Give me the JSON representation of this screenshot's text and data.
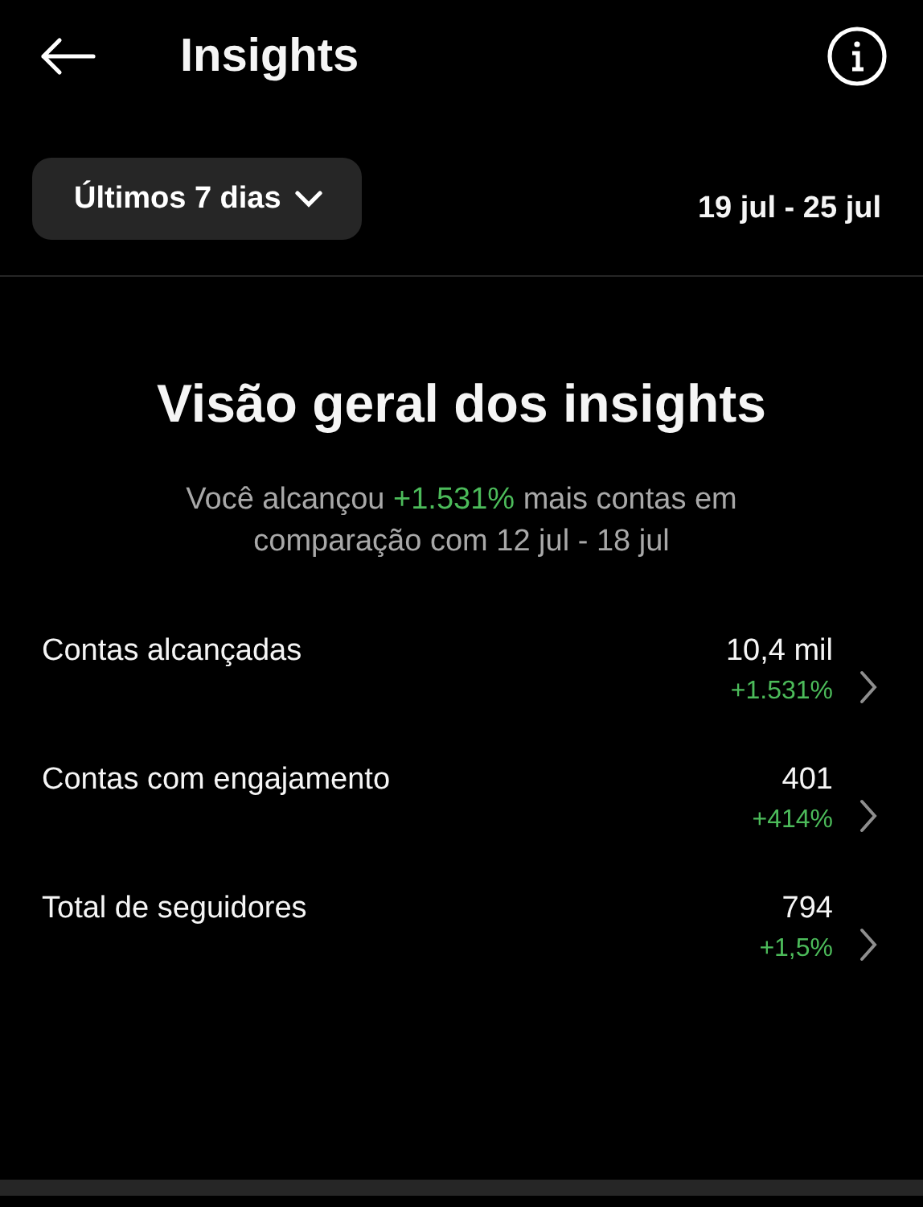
{
  "header": {
    "title": "Insights"
  },
  "filter": {
    "period": "Últimos 7 dias",
    "range": "19 jul - 25 jul"
  },
  "overview": {
    "heading": "Visão geral dos insights",
    "text_before": "Você alcançou ",
    "change": "+1.531%",
    "text_after": " mais contas em comparação com 12 jul - 18 jul"
  },
  "metrics": [
    {
      "label": "Contas alcançadas",
      "value": "10,4 mil",
      "change": "+1.531%"
    },
    {
      "label": "Contas com engajamento",
      "value": "401",
      "change": "+414%"
    },
    {
      "label": "Total de seguidores",
      "value": "794",
      "change": "+1,5%"
    }
  ]
}
